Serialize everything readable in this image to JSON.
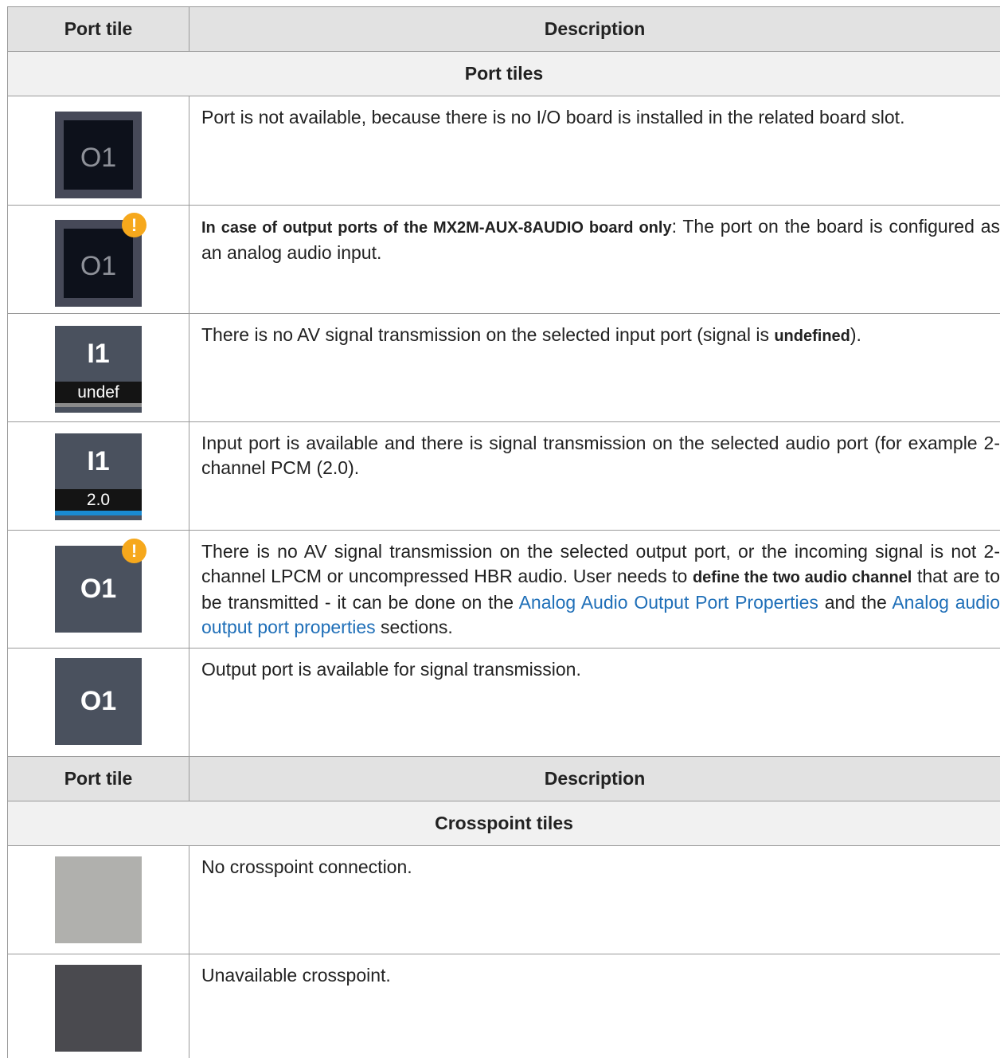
{
  "header": {
    "col1": "Port tile",
    "col2": "Description"
  },
  "sections": {
    "port_tiles": "Port tiles",
    "crosspoint_tiles": "Crosspoint tiles"
  },
  "port_rows": [
    {
      "tile_label": "O1",
      "desc": "Port is not available, because there is no I/O board is installed in the related board slot."
    },
    {
      "tile_label": "O1",
      "warn": "!",
      "desc_bold": "In case of output ports of the MX2M-AUX-8AUDIO board only",
      "desc": ": The port on the board is configured as an analog audio input."
    },
    {
      "tile_label": "I1",
      "tile_sub": "undef",
      "sub_color": "#8a8a8a",
      "desc_pre": "There is no AV signal transmission on the selected input port (signal is ",
      "desc_bold": "undefined",
      "desc_post": ")."
    },
    {
      "tile_label": "I1",
      "tile_sub": "2.0",
      "sub_color": "#1a8ad0",
      "desc": "Input port is available and there is signal transmission on the selected audio port (for example 2-channel PCM (2.0)."
    },
    {
      "tile_label": "O1",
      "warn": "!",
      "desc_pre": "There is no AV signal transmission on the selected output port, or the incoming signal is not 2-channel LPCM or uncompressed HBR audio. User needs to ",
      "desc_bold": "define the two audio channel",
      "desc_mid": " that are to be transmitted - it can be done on the ",
      "link1": "Analog Audio Output Port Properties",
      "desc_and": " and the ",
      "link2": "Analog audio output port properties",
      "desc_post": " sections."
    },
    {
      "tile_label": "O1",
      "desc": "Output port is available for signal transmission."
    }
  ],
  "crosspoint_rows": [
    {
      "color": "#b0b0ad",
      "desc": "No crosspoint connection."
    },
    {
      "color": "#4a4a4f",
      "desc": "Unavailable crosspoint."
    }
  ]
}
